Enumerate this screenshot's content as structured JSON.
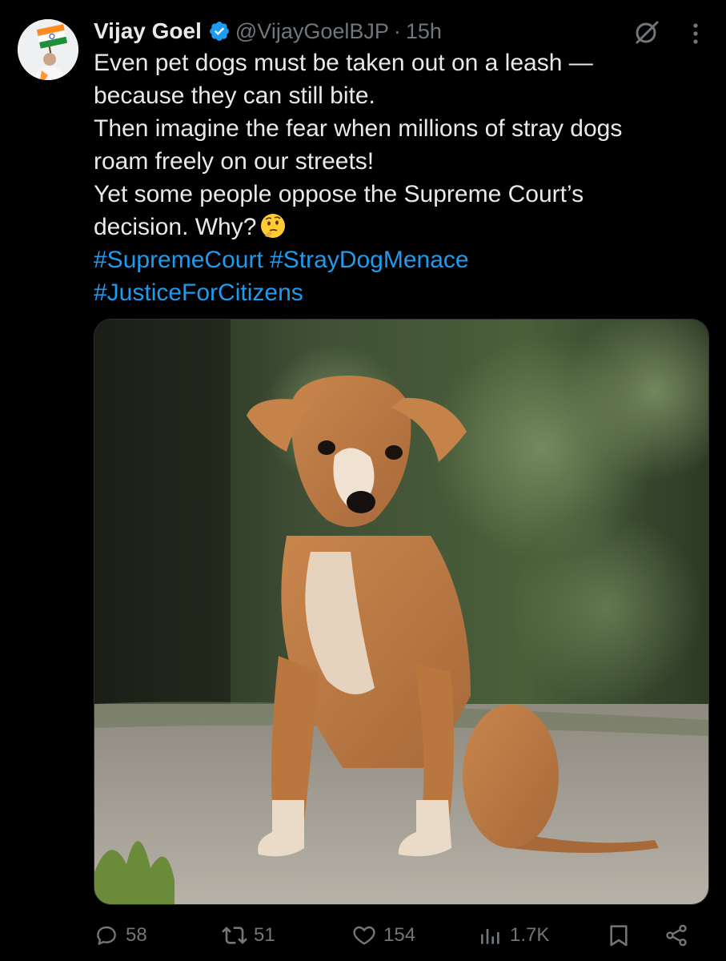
{
  "tweet": {
    "author": {
      "name": "Vijay Goel",
      "handle": "@VijayGoelBJP",
      "verified_icon": "verified-badge-icon",
      "avatar_icon": "avatar-flag-icon"
    },
    "separator": "·",
    "time": "15h",
    "text_lines": [
      "Even pet dogs must be taken out on a leash —",
      "because they can still bite.",
      "Then imagine the fear when millions of stray dogs",
      "roam freely on our streets!",
      "Yet some people oppose the Supreme Court’s",
      "decision. Why?"
    ],
    "emoji": "thinking-face-icon",
    "hashtags": [
      "#SupremeCourt",
      "#StrayDogMenace",
      "#JusticeForCitizens"
    ],
    "media_icon": "puppy-photo"
  },
  "actions": {
    "replies": "58",
    "reposts": "51",
    "likes": "154",
    "views": "1.7K",
    "bookmark_icon": "bookmark-icon",
    "share_icon": "share-icon"
  },
  "colors": {
    "background": "#000000",
    "text": "#e7e9ea",
    "muted": "#71767b",
    "link": "#1d9bf0",
    "verified": "#1d9bf0"
  }
}
